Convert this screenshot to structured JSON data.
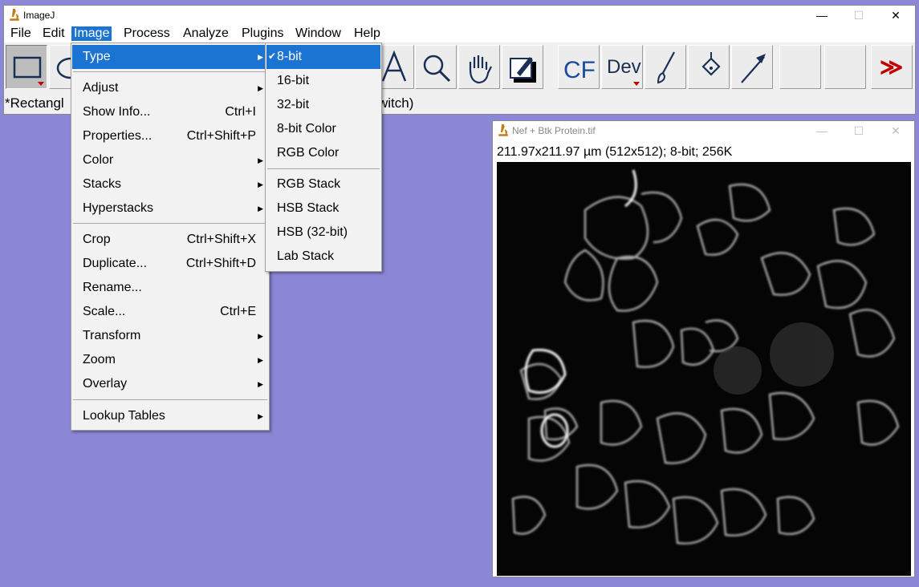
{
  "main_window": {
    "title": "ImageJ",
    "menubar": [
      "File",
      "Edit",
      "Image",
      "Process",
      "Analyze",
      "Plugins",
      "Window",
      "Help"
    ],
    "active_menu": "Image",
    "status_left": "*Rectangl",
    "status_right": "witch)",
    "toolbar_right": {
      "cf_label": "CF",
      "dev_label": "Dev",
      "more_label": "≫"
    },
    "controls": {
      "minimize": "—",
      "maximize": "☐",
      "close": "✕"
    }
  },
  "image_menu": [
    {
      "label": "Type",
      "submenu": true,
      "highlighted": true
    },
    {
      "separator": true
    },
    {
      "label": "Adjust",
      "submenu": true
    },
    {
      "label": "Show Info...",
      "shortcut": "Ctrl+I"
    },
    {
      "label": "Properties...",
      "shortcut": "Ctrl+Shift+P"
    },
    {
      "label": "Color",
      "submenu": true
    },
    {
      "label": "Stacks",
      "submenu": true
    },
    {
      "label": "Hyperstacks",
      "submenu": true
    },
    {
      "separator": true
    },
    {
      "label": "Crop",
      "shortcut": "Ctrl+Shift+X"
    },
    {
      "label": "Duplicate...",
      "shortcut": "Ctrl+Shift+D"
    },
    {
      "label": "Rename..."
    },
    {
      "label": "Scale...",
      "shortcut": "Ctrl+E"
    },
    {
      "label": "Transform",
      "submenu": true
    },
    {
      "label": "Zoom",
      "submenu": true
    },
    {
      "label": "Overlay",
      "submenu": true
    },
    {
      "separator": true
    },
    {
      "label": "Lookup Tables",
      "submenu": true
    }
  ],
  "type_submenu": [
    {
      "label": "8-bit",
      "checked": true,
      "highlighted": true
    },
    {
      "label": "16-bit"
    },
    {
      "label": "32-bit"
    },
    {
      "label": "8-bit Color"
    },
    {
      "label": "RGB Color"
    },
    {
      "separator": true
    },
    {
      "label": "RGB Stack"
    },
    {
      "label": "HSB Stack"
    },
    {
      "label": "HSB (32-bit)"
    },
    {
      "label": "Lab Stack"
    }
  ],
  "image_window": {
    "title": "Nef + Btk Protein.tif",
    "info": "211.97x211.97 µm (512x512); 8-bit; 256K",
    "controls": {
      "minimize": "—",
      "maximize": "☐",
      "close": "✕"
    }
  },
  "colors": {
    "desktop": "#8b86d6",
    "highlight": "#1b74d2",
    "menu_bg": "#f2f2f2"
  }
}
